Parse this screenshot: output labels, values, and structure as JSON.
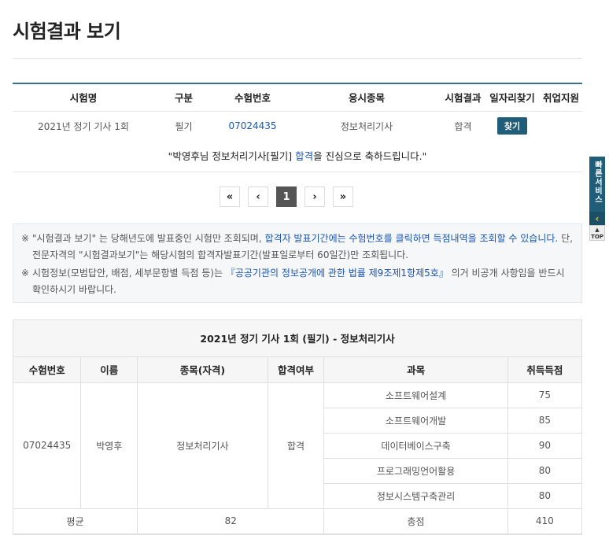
{
  "page": {
    "title": "시험결과 보기"
  },
  "summary": {
    "headers": [
      "시험명",
      "구분",
      "수험번호",
      "응시종목",
      "시험결과",
      "일자리찾기",
      "취업지원"
    ],
    "row": {
      "exam_name": "2021년 정기 기사 1회",
      "type": "필기",
      "exam_number": "07024435",
      "subject": "정보처리기사",
      "result": "합격",
      "find_button": "찾기"
    },
    "congrats_prefix": "\"박영후님 정보처리기사[필기] ",
    "congrats_highlight": "합격",
    "congrats_suffix": "을 진심으로 축하드립니다.\""
  },
  "pager": {
    "first": "«",
    "prev": "‹",
    "current": "1",
    "next": "›",
    "last": "»"
  },
  "notice": {
    "mark": "※",
    "line1_a": "\"시험결과 보기\" 는 당해년도에 발표중인 시험만 조회되며, ",
    "line1_b": "합격자 발표기간에는 수험번호를 클릭하면 득점내역을 조회할 수 있습니다.",
    "line1_c": " 단, 전문자격의 \"시험결과보기\"는 해당시험의 합격자발표기간(발표일로부터 60일간)만 조회됩니다.",
    "line2_a": "시험정보(모범답안, 배점, 세부문항별 득점 등)는 ",
    "line2_b": "『공공기관의 정보공개에 관한 법률 제9조제1항제5호』",
    "line2_c": " 의거 비공개 사항임을 반드시 확인하시기 바랍니다."
  },
  "result": {
    "title": "2021년 정기 기사 1회 (필기) - 정보처리기사",
    "headers": [
      "수험번호",
      "이름",
      "종목(자격)",
      "합격여부",
      "과목",
      "취득득점"
    ],
    "exam_number": "07024435",
    "name": "박영후",
    "qualification": "정보처리기사",
    "pass": "합격",
    "subjects": [
      {
        "name": "소프트웨어설계",
        "score": "75"
      },
      {
        "name": "소프트웨어개발",
        "score": "85"
      },
      {
        "name": "데이터베이스구축",
        "score": "90"
      },
      {
        "name": "프로그래밍언어활용",
        "score": "80"
      },
      {
        "name": "정보시스템구축관리",
        "score": "80"
      }
    ],
    "average_label": "평균",
    "average_value": "82",
    "total_label": "총점",
    "total_value": "410"
  },
  "side": {
    "tab_label": "빠른서비스",
    "arrow": "‹",
    "top_label": "TOP"
  }
}
